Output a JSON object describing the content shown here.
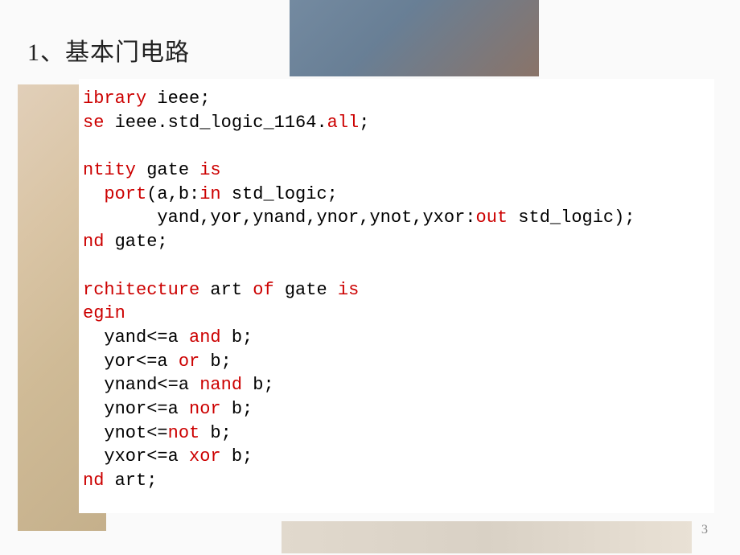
{
  "slide": {
    "title_num": "1",
    "title_sep": "、",
    "title_text": "基本门电路",
    "page_number": "3"
  },
  "code": {
    "l01_k1": "ibrary",
    "l01_t1": " ieee;",
    "l02_k1": "se",
    "l02_t1": " ieee.std_logic_1164.",
    "l02_k2": "all",
    "l02_t2": ";",
    "l04_k1": "ntity",
    "l04_t1": " gate ",
    "l04_k2": "is",
    "l05_pad": "  ",
    "l05_k1": "port",
    "l05_t1": "(a,b:",
    "l05_k2": "in",
    "l05_t2": " std_logic;",
    "l06_pad": "       ",
    "l06_t1": "yand,yor,ynand,ynor,ynot,yxor:",
    "l06_k1": "out",
    "l06_t2": " std_logic);",
    "l07_k1": "nd",
    "l07_t1": " gate;",
    "l09_k1": "rchitecture",
    "l09_t1": " art ",
    "l09_k2": "of",
    "l09_t2": " gate ",
    "l09_k3": "is",
    "l10_k1": "egin",
    "l11_pad": "  ",
    "l11_t1": "yand<=a ",
    "l11_k1": "and",
    "l11_t2": " b;",
    "l12_pad": "  ",
    "l12_t1": "yor<=a ",
    "l12_k1": "or",
    "l12_t2": " b;",
    "l13_pad": "  ",
    "l13_t1": "ynand<=a ",
    "l13_k1": "nand",
    "l13_t2": " b;",
    "l14_pad": "  ",
    "l14_t1": "ynor<=a ",
    "l14_k1": "nor",
    "l14_t2": " b;",
    "l15_pad": "  ",
    "l15_t1": "ynot<=",
    "l15_k1": "not",
    "l15_t2": " b;",
    "l16_pad": "  ",
    "l16_t1": "yxor<=a ",
    "l16_k1": "xor",
    "l16_t2": " b;",
    "l17_k1": "nd",
    "l17_t1": " art;"
  }
}
